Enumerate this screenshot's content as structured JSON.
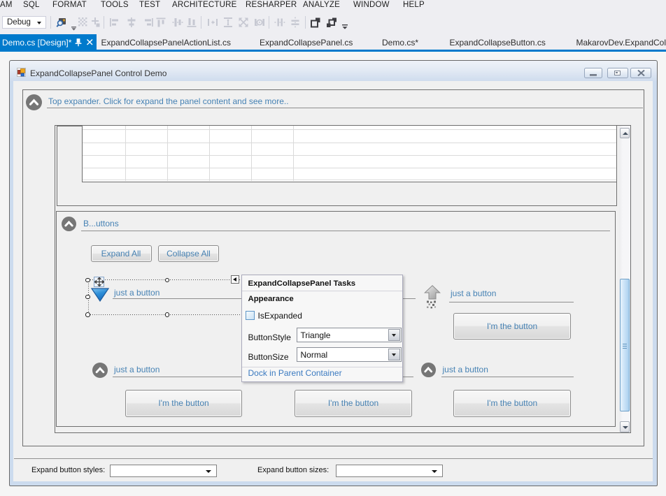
{
  "colors": {
    "accent": "#007acc",
    "steelblue": "#4682b4",
    "link_blue": "#3b7ac0"
  },
  "menu": {
    "items": [
      {
        "label": "AM"
      },
      {
        "label": "SQL"
      },
      {
        "label": "FORMAT"
      },
      {
        "label": "TOOLS"
      },
      {
        "label": "TEST"
      },
      {
        "label": "ARCHITECTURE"
      },
      {
        "label": "RESHARPER"
      },
      {
        "label": "ANALYZE"
      },
      {
        "label": "WINDOW"
      },
      {
        "label": "HELP"
      }
    ]
  },
  "toolbar": {
    "debug_value": "Debug",
    "icons": [
      {
        "name": "find-selector-icon",
        "enabled": true
      },
      {
        "name": "toolbar-group-dropdown-icon",
        "enabled": true
      },
      {
        "name": "grid-dots-icon",
        "enabled": false
      },
      {
        "name": "move-cross-icon",
        "enabled": false
      },
      {
        "name": "align-lefts-icon",
        "enabled": false
      },
      {
        "name": "align-centers-icon",
        "enabled": false
      },
      {
        "name": "align-rights-icon",
        "enabled": false
      },
      {
        "name": "align-tops-icon",
        "enabled": false
      },
      {
        "name": "align-middles-icon",
        "enabled": false
      },
      {
        "name": "align-bottoms-icon",
        "enabled": false
      },
      {
        "name": "same-width-icon",
        "enabled": false
      },
      {
        "name": "same-height-icon",
        "enabled": false
      },
      {
        "name": "same-size-icon",
        "enabled": false
      },
      {
        "name": "size-to-grid-icon",
        "enabled": false
      },
      {
        "name": "horizontal-spacing-icon",
        "enabled": false
      },
      {
        "name": "vertical-spacing-icon",
        "enabled": false
      },
      {
        "name": "bring-to-front-icon",
        "enabled": true
      },
      {
        "name": "send-to-back-icon",
        "enabled": true
      },
      {
        "name": "toolbar-overflow-icon",
        "enabled": true
      }
    ]
  },
  "tabs": {
    "active": {
      "title": "Demo.cs [Design]*"
    },
    "items": [
      {
        "title": "ExpandCollapsePanelActionList.cs"
      },
      {
        "title": "ExpandCollapsePanel.cs"
      },
      {
        "title": "Demo.cs*"
      },
      {
        "title": "ExpandCollapseButton.cs"
      },
      {
        "title": "MakarovDev.ExpandColl"
      }
    ]
  },
  "form": {
    "title": "ExpandCollapsePanel Control Demo",
    "top_expander_label": "Top expander. Click for expand the panel content and see more..",
    "buttons_group_label": "B...uttons",
    "expand_all": "Expand All",
    "collapse_all": "Collapse All",
    "panel_labels": [
      {
        "text": "just a button"
      },
      {
        "text": "just a button"
      },
      {
        "text": "just a button"
      },
      {
        "text": "just a button"
      }
    ],
    "demo_buttons": [
      {
        "text": "I'm the button"
      },
      {
        "text": "I'm the button"
      },
      {
        "text": "I'm the button"
      },
      {
        "text": "I'm the button"
      }
    ],
    "styles_label": "Expand button styles:",
    "sizes_label": "Expand button sizes:"
  },
  "smart_tag": {
    "title": "ExpandCollapsePanel Tasks",
    "section": "Appearance",
    "checkbox_label": "IsExpanded",
    "checkbox_checked": false,
    "button_style_label": "ButtonStyle",
    "button_style_value": "Triangle",
    "button_size_label": "ButtonSize",
    "button_size_value": "Normal",
    "link": "Dock in Parent Container"
  }
}
